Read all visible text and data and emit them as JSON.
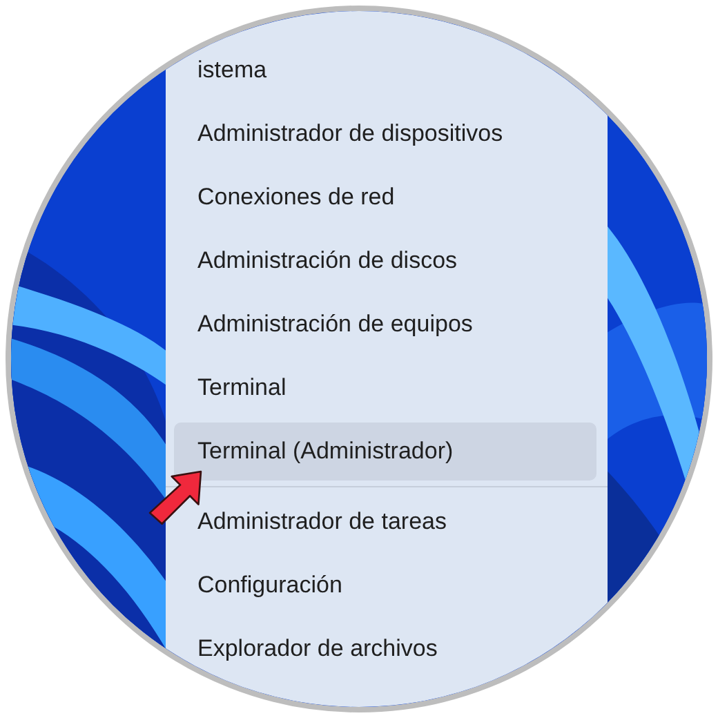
{
  "menu": {
    "items": [
      {
        "label": "istema",
        "selected": false,
        "divider_after": false
      },
      {
        "label": "Administrador de dispositivos",
        "selected": false,
        "divider_after": false
      },
      {
        "label": "Conexiones de red",
        "selected": false,
        "divider_after": false
      },
      {
        "label": "Administración de discos",
        "selected": false,
        "divider_after": false
      },
      {
        "label": "Administración de equipos",
        "selected": false,
        "divider_after": false
      },
      {
        "label": "Terminal",
        "selected": false,
        "divider_after": false
      },
      {
        "label": "Terminal (Administrador)",
        "selected": true,
        "divider_after": true
      },
      {
        "label": "Administrador de tareas",
        "selected": false,
        "divider_after": false
      },
      {
        "label": "Configuración",
        "selected": false,
        "divider_after": false
      },
      {
        "label": "Explorador de archivos",
        "selected": false,
        "divider_after": false
      }
    ]
  }
}
